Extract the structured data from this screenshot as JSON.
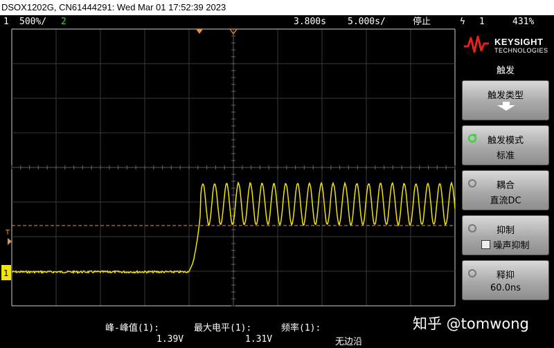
{
  "titlebar": {
    "text": "DSOX1202G, CN61444291: Wed Mar 01 17:52:39 2023"
  },
  "status": {
    "ch1_num": "1",
    "ch1_scale": "500%/",
    "ch2_num": "2",
    "time_delay": "3.800s",
    "time_scale": "5.000s/",
    "run_state": "停止",
    "trig_icon": "ϟ",
    "trig_source": "1",
    "trig_level": "431%"
  },
  "screen": {
    "trigger_marker": "T",
    "channel_marker": "1",
    "colors": {
      "trace": "#f2e600",
      "grid": "#3a3a3a",
      "trigger_line": "#e8924a",
      "axis": "#d0d0d0"
    }
  },
  "measurements": [
    {
      "label": "峰-峰值(1):",
      "value": "1.39V"
    },
    {
      "label": "最大电平(1):",
      "value": "1.31V"
    },
    {
      "label": "频率(1):",
      "value": "无边沿"
    }
  ],
  "side": {
    "brand": "KEYSIGHT",
    "brand_sub": "TECHNOLOGIES",
    "menu_title": "触发",
    "keys": [
      {
        "l1": "触发类型",
        "l2": ""
      },
      {
        "l1": "触发模式",
        "l2": "标准"
      },
      {
        "l1": "耦合",
        "l2": "直流DC"
      },
      {
        "l1": "抑制",
        "l2": "噪声抑制"
      },
      {
        "l1": "释抑",
        "l2": "60.0ns"
      }
    ]
  },
  "watermark": "知乎 @tomwong"
}
